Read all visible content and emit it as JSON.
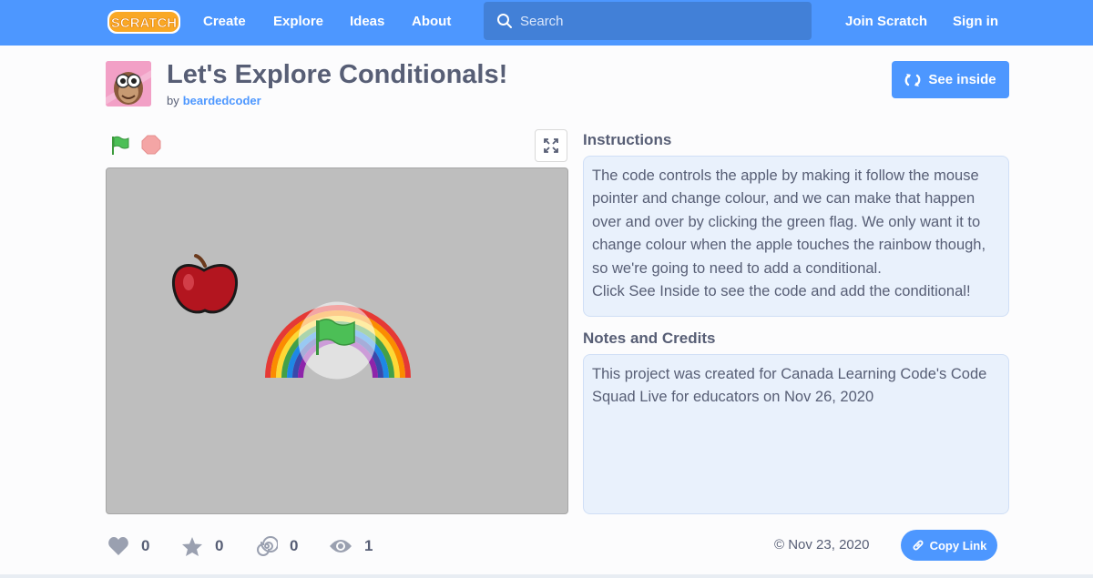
{
  "nav": {
    "logo_text": "SCRATCH",
    "links": [
      "Create",
      "Explore",
      "Ideas",
      "About"
    ],
    "search_placeholder": "Search",
    "join": "Join Scratch",
    "signin": "Sign in"
  },
  "project": {
    "title": "Let's Explore Conditionals!",
    "by": "by",
    "author": "beardedcoder",
    "see_inside": "See inside"
  },
  "instructions": {
    "heading": "Instructions",
    "lines": [
      "The code controls the apple by making it follow the mouse pointer and change colour, and we can make that happen over and over by clicking the green flag. We only want it to change colour when the apple touches the rainbow though, so we're going to need to add a conditional.",
      "Click See Inside to see the code and add the conditional!"
    ]
  },
  "notes": {
    "heading": "Notes and Credits",
    "text": "This project was created for Canada Learning Code's Code Squad Live for educators on Nov 26, 2020"
  },
  "stats": {
    "loves": "0",
    "favorites": "0",
    "remixes": "0",
    "views": "1"
  },
  "footer": {
    "date": "© Nov 23, 2020",
    "copy_link": "Copy Link"
  },
  "colors": {
    "accent": "#4d97ff",
    "text": "#575e75",
    "stage_bg": "#bebebe",
    "note_bg": "#e9f1fc"
  }
}
